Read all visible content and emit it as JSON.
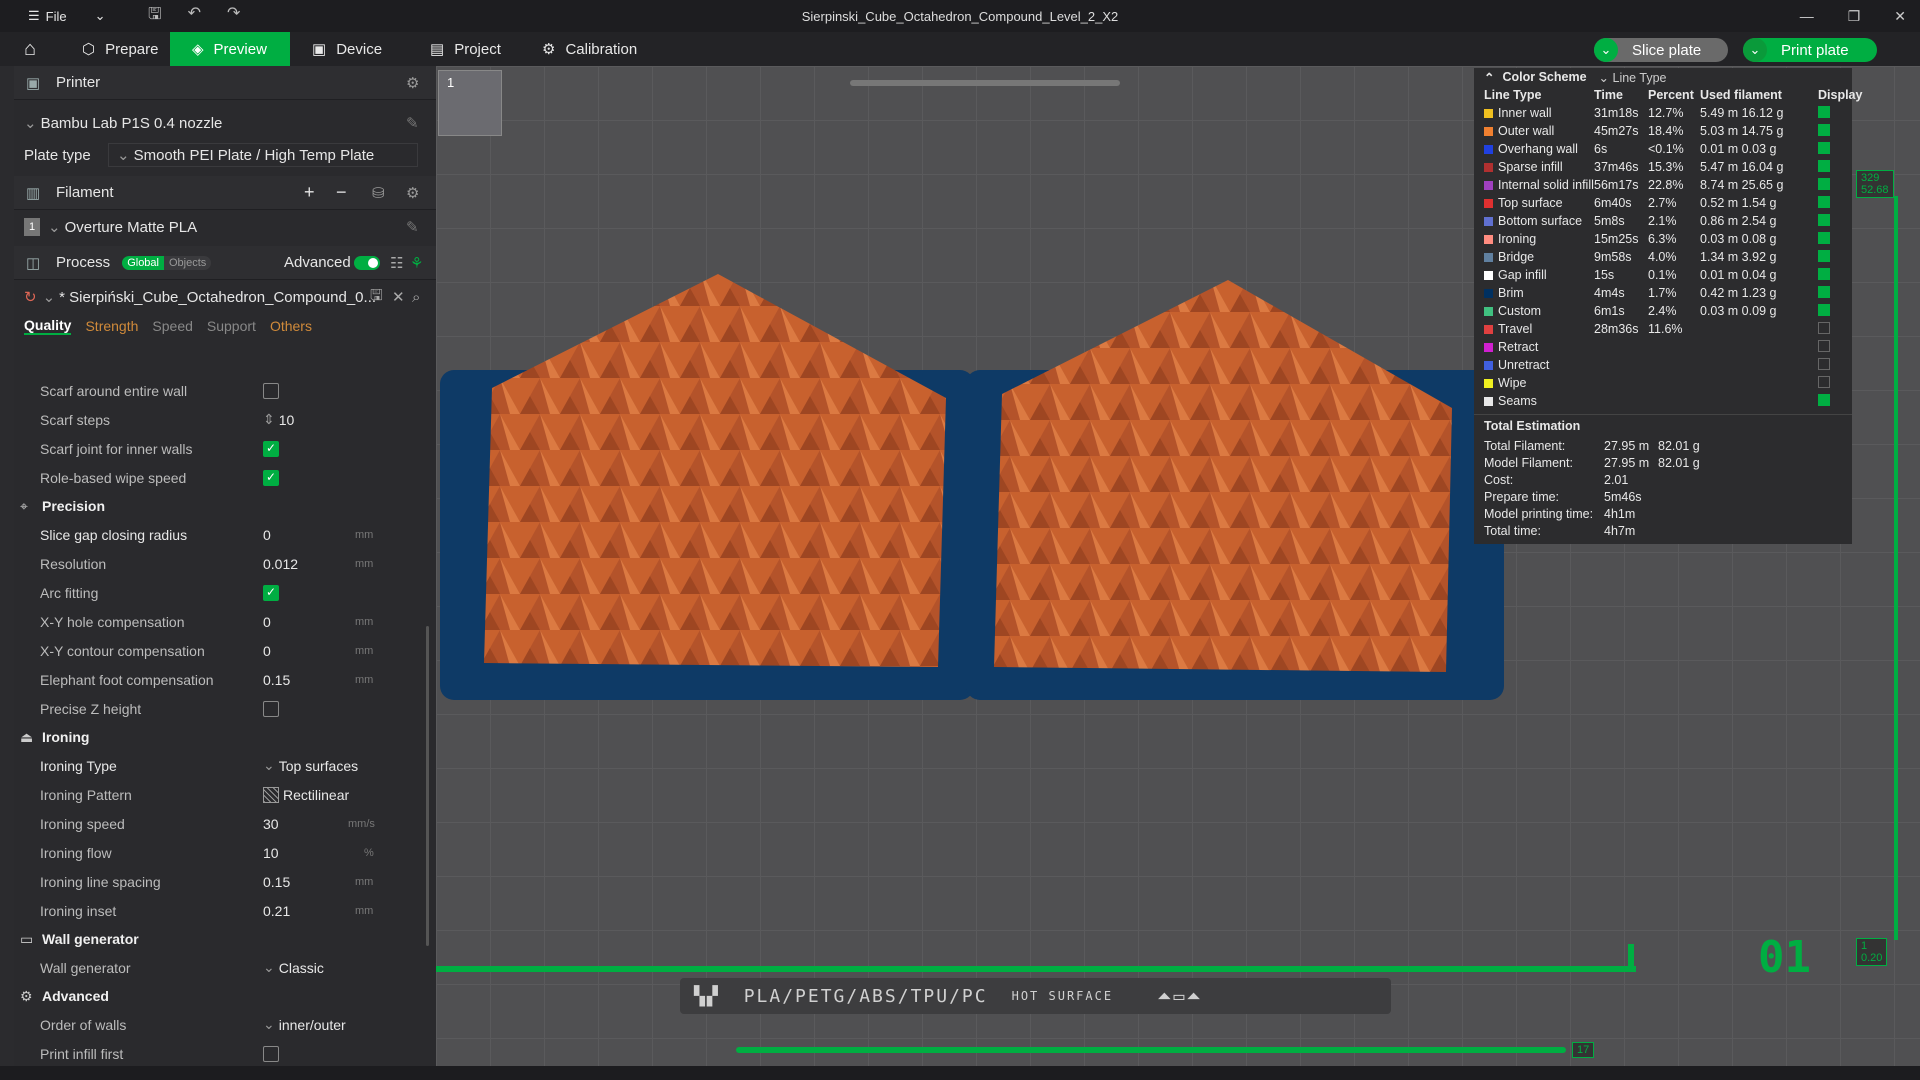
{
  "window": {
    "menu_label": "File",
    "title": "Sierpinski_Cube_Octahedron_Compound_Level_2_X2"
  },
  "tabs": [
    {
      "label": "Prepare"
    },
    {
      "label": "Preview"
    },
    {
      "label": "Device"
    },
    {
      "label": "Project"
    },
    {
      "label": "Calibration"
    }
  ],
  "actions": {
    "slice": "Slice plate",
    "print": "Print plate"
  },
  "printer": {
    "section": "Printer",
    "model": "Bambu Lab P1S 0.4 nozzle",
    "plate_type_label": "Plate type",
    "plate_type": "Smooth PEI Plate / High Temp Plate"
  },
  "filament": {
    "section": "Filament",
    "slot": "1",
    "name": "Overture Matte PLA"
  },
  "process": {
    "section": "Process",
    "global": "Global",
    "objects": "Objects",
    "advanced": "Advanced",
    "file": "* Sierpiński_Cube_Octahedron_Compound_0..."
  },
  "quality_tabs": [
    "Quality",
    "Strength",
    "Speed",
    "Support",
    "Others"
  ],
  "settings": {
    "scarf_wall": "Scarf around entire wall",
    "scarf_steps": "Scarf steps",
    "scarf_steps_val": "10",
    "scarf_inner": "Scarf joint for inner walls",
    "role_wipe": "Role-based wipe speed",
    "precision": "Precision",
    "slice_gap": "Slice gap closing radius",
    "slice_gap_val": "0",
    "resolution": "Resolution",
    "resolution_val": "0.012",
    "arc": "Arc fitting",
    "xy_hole": "X-Y hole compensation",
    "xy_hole_val": "0",
    "xy_contour": "X-Y contour compensation",
    "xy_contour_val": "0",
    "elephant": "Elephant foot compensation",
    "elephant_val": "0.15",
    "precise_z": "Precise Z height",
    "ironing": "Ironing",
    "ironing_type": "Ironing Type",
    "ironing_type_val": "Top surfaces",
    "ironing_pattern": "Ironing Pattern",
    "ironing_pattern_val": "Rectilinear",
    "ironing_speed": "Ironing speed",
    "ironing_speed_val": "30",
    "ironing_flow": "Ironing flow",
    "ironing_flow_val": "10",
    "ironing_spacing": "Ironing line spacing",
    "ironing_spacing_val": "0.15",
    "ironing_inset": "Ironing inset",
    "ironing_inset_val": "0.21",
    "wall_gen": "Wall generator",
    "wall_gen_label": "Wall generator",
    "wall_gen_val": "Classic",
    "advanced": "Advanced",
    "order_walls": "Order of walls",
    "order_walls_val": "inner/outer",
    "print_infill": "Print infill first",
    "unit_mm": "mm",
    "unit_mms": "mm/s",
    "unit_pct": "%"
  },
  "legend": {
    "title": "Color Scheme",
    "scheme": "Line Type",
    "headers": [
      "Line Type",
      "Time",
      "Percent",
      "Used filament",
      "Display"
    ],
    "rows": [
      {
        "name": "Inner wall",
        "color": "#f0c020",
        "time": "31m18s",
        "pct": "12.7%",
        "fil": "5.49 m  16.12 g",
        "on": true
      },
      {
        "name": "Outer wall",
        "color": "#f08030",
        "time": "45m27s",
        "pct": "18.4%",
        "fil": "5.03 m  14.75 g",
        "on": true
      },
      {
        "name": "Overhang wall",
        "color": "#2040e0",
        "time": "6s",
        "pct": "<0.1%",
        "fil": "0.01 m  0.03 g",
        "on": true
      },
      {
        "name": "Sparse infill",
        "color": "#b03030",
        "time": "37m46s",
        "pct": "15.3%",
        "fil": "5.47 m  16.04 g",
        "on": true
      },
      {
        "name": "Internal solid infill",
        "color": "#a040c0",
        "time": "56m17s",
        "pct": "22.8%",
        "fil": "8.74 m  25.65 g",
        "on": true
      },
      {
        "name": "Top surface",
        "color": "#e03030",
        "time": "6m40s",
        "pct": "2.7%",
        "fil": "0.52 m  1.54 g",
        "on": true
      },
      {
        "name": "Bottom surface",
        "color": "#6070d0",
        "time": "5m8s",
        "pct": "2.1%",
        "fil": "0.86 m  2.54 g",
        "on": true
      },
      {
        "name": "Ironing",
        "color": "#ff8c80",
        "time": "15m25s",
        "pct": "6.3%",
        "fil": "0.03 m  0.08 g",
        "on": true
      },
      {
        "name": "Bridge",
        "color": "#6080a0",
        "time": "9m58s",
        "pct": "4.0%",
        "fil": "1.34 m  3.92 g",
        "on": true
      },
      {
        "name": "Gap infill",
        "color": "#ffffff",
        "time": "15s",
        "pct": "0.1%",
        "fil": "0.01 m  0.04 g",
        "on": true
      },
      {
        "name": "Brim",
        "color": "#003060",
        "time": "4m4s",
        "pct": "1.7%",
        "fil": "0.42 m  1.23 g",
        "on": true
      },
      {
        "name": "Custom",
        "color": "#40c080",
        "time": "6m1s",
        "pct": "2.4%",
        "fil": "0.03 m  0.09 g",
        "on": true
      },
      {
        "name": "Travel",
        "color": "#e04040",
        "time": "28m36s",
        "pct": "11.6%",
        "fil": "",
        "on": false
      },
      {
        "name": "Retract",
        "color": "#d020d0",
        "time": "",
        "pct": "",
        "fil": "",
        "on": false
      },
      {
        "name": "Unretract",
        "color": "#4060e0",
        "time": "",
        "pct": "",
        "fil": "",
        "on": false
      },
      {
        "name": "Wipe",
        "color": "#f0f020",
        "time": "",
        "pct": "",
        "fil": "",
        "on": false
      },
      {
        "name": "Seams",
        "color": "#e8e8e8",
        "time": "",
        "pct": "",
        "fil": "",
        "on": true
      }
    ],
    "estimation_title": "Total Estimation",
    "estimation": [
      {
        "k": "Total Filament:",
        "v1": "27.95 m",
        "v2": "82.01 g"
      },
      {
        "k": "Model Filament:",
        "v1": "27.95 m",
        "v2": "82.01 g"
      },
      {
        "k": "Cost:",
        "v1": "2.01",
        "v2": ""
      },
      {
        "k": "Prepare time:",
        "v1": "5m46s",
        "v2": ""
      },
      {
        "k": "Model printing time:",
        "v1": "4h1m",
        "v2": ""
      },
      {
        "k": "Total time:",
        "v1": "4h7m",
        "v2": ""
      }
    ]
  },
  "viewport": {
    "plate_index": "1",
    "plate_text": "PLA/PETG/ABS/TPU/PC",
    "hot_surface": "HOT SURFACE",
    "layer_top": "329",
    "layer_top_z": "52.68",
    "layer_bottom": "1",
    "layer_bottom_z": "0.20",
    "horiz_layer": "17",
    "plate_number": "01"
  }
}
